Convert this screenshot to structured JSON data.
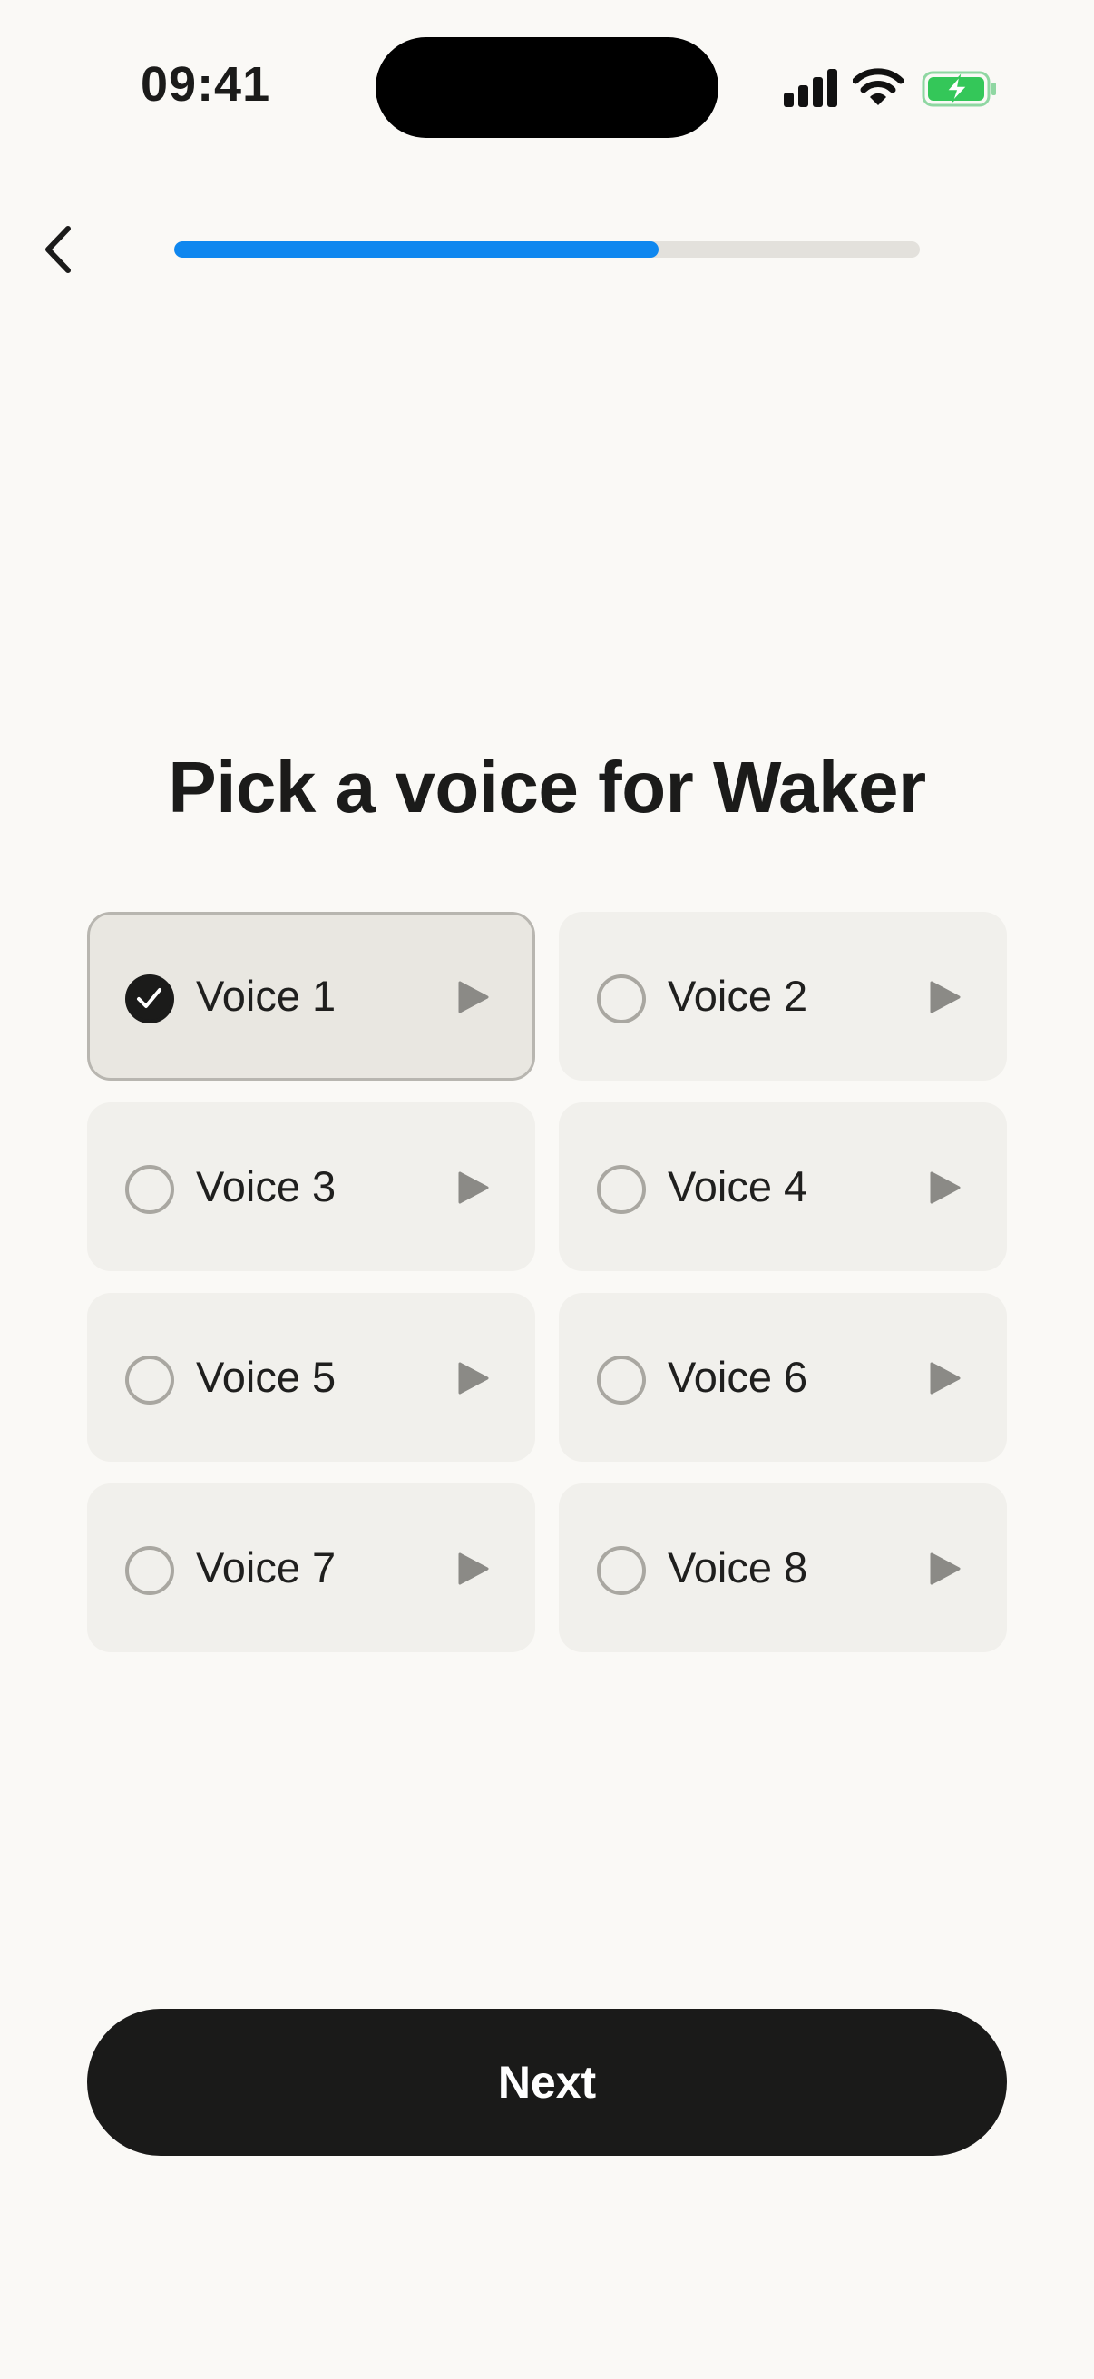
{
  "status_bar": {
    "time": "09:41"
  },
  "progress": {
    "value": 0.65,
    "color": "#0f87ef"
  },
  "header": {
    "back_icon": "chevron-left-icon"
  },
  "title": "Pick a voice for Waker",
  "voices": [
    {
      "label": "Voice 1",
      "selected": true
    },
    {
      "label": "Voice 2",
      "selected": false
    },
    {
      "label": "Voice 3",
      "selected": false
    },
    {
      "label": "Voice 4",
      "selected": false
    },
    {
      "label": "Voice 5",
      "selected": false
    },
    {
      "label": "Voice 6",
      "selected": false
    },
    {
      "label": "Voice 7",
      "selected": false
    },
    {
      "label": "Voice 8",
      "selected": false
    }
  ],
  "next_button": {
    "label": "Next"
  },
  "colors": {
    "background": "#faf9f6",
    "accent": "#0f87ef",
    "battery": "#34c759"
  }
}
